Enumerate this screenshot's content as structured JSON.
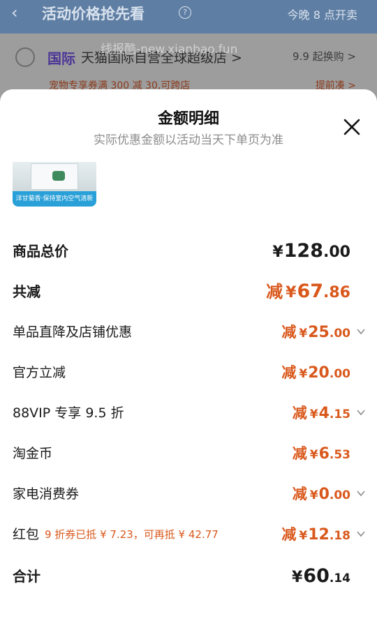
{
  "background": {
    "header_title": "活动价格抢先看",
    "header_right": "今晚 8 点开卖",
    "watermark": "线报酷-new.xianbao.fun",
    "store_tag": "国际",
    "store_name": "天猫国际自营全球超级店 >",
    "store_promo": "9.9 起换购 >",
    "coupon_text": "宠物专享券满 300 减 30,可跨店",
    "coupon_action": "提前凑 >"
  },
  "sheet": {
    "title": "金额明细",
    "subtitle": "实际优惠金额以活动当天下单页为准",
    "product_band_text": "洋甘菊香·保持室内空气清新"
  },
  "rows": {
    "total": {
      "label": "商品总价",
      "yen": "¥",
      "int": "128",
      "dec": ".00"
    },
    "reduced": {
      "label": "共减",
      "minus": "减",
      "yen": "¥",
      "int": "67",
      "dec": ".86"
    },
    "direct": {
      "label": "单品直降及店铺优惠",
      "minus": "减",
      "yen": "¥",
      "int": "25",
      "dec": ".00"
    },
    "official": {
      "label": "官方立减",
      "minus": "减",
      "yen": "¥",
      "int": "20",
      "dec": ".00"
    },
    "vip": {
      "label": "88VIP 专享 9.5 折",
      "minus": "减",
      "yen": "¥",
      "int": "4",
      "dec": ".15"
    },
    "coin": {
      "label": "淘金币",
      "minus": "减",
      "yen": "¥",
      "int": "6",
      "dec": ".53"
    },
    "appliance": {
      "label": "家电消费券",
      "minus": "减",
      "yen": "¥",
      "int": "0",
      "dec": ".00"
    },
    "redpacket": {
      "label": "红包",
      "note": "9 折券已抵 ¥ 7.23，可再抵 ¥ 42.77",
      "minus": "减",
      "yen": "¥",
      "int": "12",
      "dec": ".18"
    },
    "sum": {
      "label": "合计",
      "yen": "¥",
      "int": "60",
      "dec": ".14"
    }
  },
  "colors": {
    "accent": "#d9581c",
    "text": "#1a1a1a",
    "muted": "#8c8c8c"
  },
  "icons": [
    "back-arrow-icon",
    "help-icon",
    "close-icon",
    "chevron-down-icon"
  ]
}
